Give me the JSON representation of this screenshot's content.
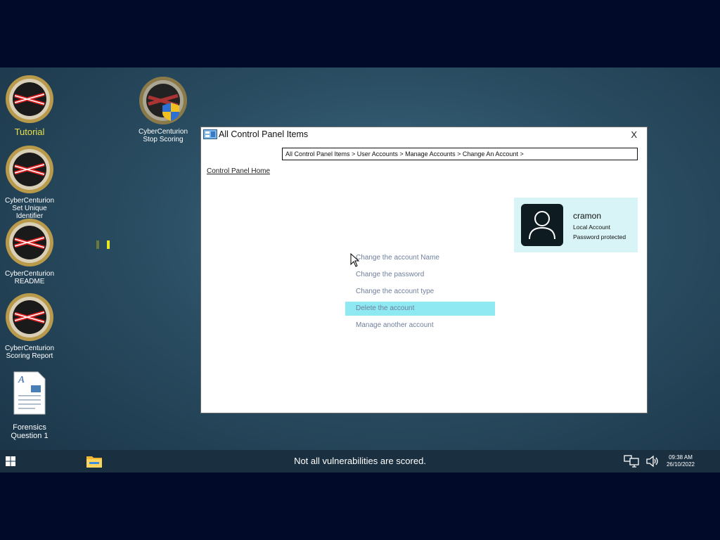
{
  "desktop": {
    "icons": [
      {
        "label": "Tutorial"
      },
      {
        "label": "CyberCenturion Set Unique Identifier"
      },
      {
        "label": "CyberCenturion README"
      },
      {
        "label": "CyberCenturion Scoring Report"
      },
      {
        "label": "Forensics Question 1"
      },
      {
        "label": "CyberCenturion Stop Scoring"
      }
    ]
  },
  "window": {
    "title": "All Control Panel Items",
    "close_label": "X",
    "breadcrumb": "All Control Panel Items > User Accounts > Manage Accounts > Change An Account >",
    "home_link": "Control Panel Home",
    "actions": [
      "Change the account Name",
      "Change the password",
      "Change the account type",
      "Delete the account",
      "Manage another account"
    ],
    "account": {
      "name": "cramon",
      "type": "Local Account",
      "status": "Password protected"
    }
  },
  "taskbar": {
    "message": "Not all vulnerabilities are scored.",
    "time": "09:38 AM",
    "date": "26/10/2022"
  },
  "colors": {
    "selected_action": "#8ee9f2",
    "tutorial_label": "#e8e04a",
    "action_text": "#6f7f9b"
  }
}
